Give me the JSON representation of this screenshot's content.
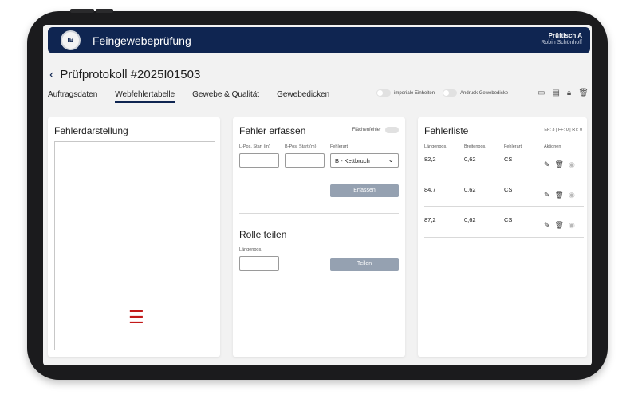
{
  "app": {
    "title": "Feingewebeprüfung",
    "logo_text": "IB",
    "station": "Prüftisch A",
    "user": "Robin Schönhoff"
  },
  "header": {
    "back_icon": "chevron-left-icon",
    "title": "Prüfprotokoll #2025I01503"
  },
  "tabs": [
    {
      "label": "Auftragsdaten",
      "active": false
    },
    {
      "label": "Webfehlertabelle",
      "active": true
    },
    {
      "label": "Gewebe & Qualität",
      "active": false
    },
    {
      "label": "Gewebedicken",
      "active": false
    }
  ],
  "toggles": {
    "imperial_label": "imperiale Einheiten",
    "print_label": "Andruck Gewebedicke"
  },
  "toolbar": {
    "icons": [
      "save-icon",
      "document-icon",
      "lock-icon",
      "trash-icon"
    ]
  },
  "defect_display": {
    "title": "Fehlerdarstellung",
    "marker_icon": "menu-icon",
    "marker_color": "#c21a1a"
  },
  "record_defect": {
    "title": "Fehler erfassen",
    "surface_label": "Flächenfehler",
    "l_pos_label": "L-Pos. Start (m)",
    "b_pos_label": "B-Pos. Start (m)",
    "type_label": "Fehlerart",
    "type_value": "B - Kettbruch",
    "submit_label": "Erfassen"
  },
  "split_roll": {
    "title": "Rolle teilen",
    "length_label": "Längenpos.",
    "submit_label": "Teilen"
  },
  "defect_list": {
    "title": "Fehlerliste",
    "counts": "EF: 3 | FF: 0 | RT: 0",
    "columns": [
      "Längenpos.",
      "Breitenpos.",
      "Fehlerart",
      "Aktionen"
    ],
    "rows": [
      {
        "length": "82,2",
        "width": "0,62",
        "type": "CS"
      },
      {
        "length": "84,7",
        "width": "0,62",
        "type": "CS"
      },
      {
        "length": "87,2",
        "width": "0,62",
        "type": "CS"
      }
    ]
  },
  "colors": {
    "brand": "#0f2551",
    "button": "#95a1b1"
  }
}
